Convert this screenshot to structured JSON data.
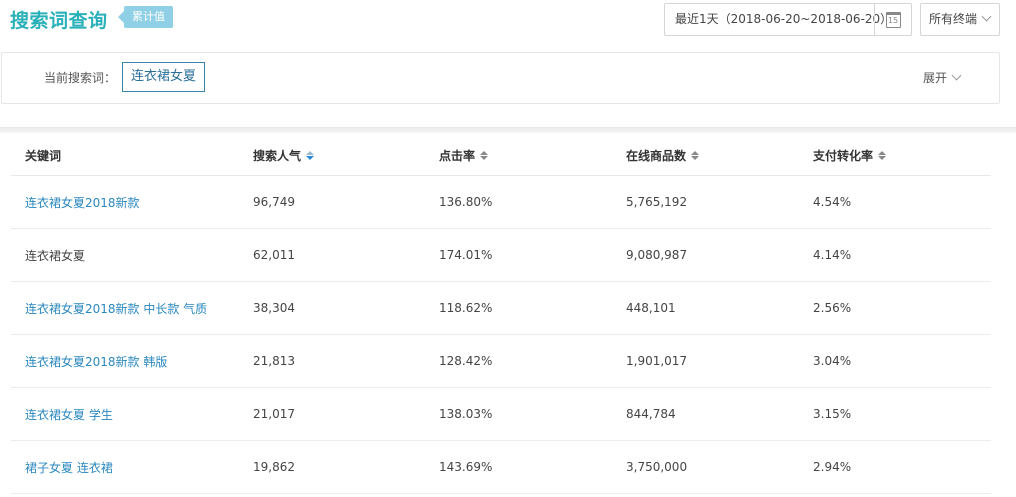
{
  "header": {
    "title": "搜索词查询",
    "badge": "累计值",
    "date_range": "最近1天（2018-06-20~2018-06-20）",
    "calendar_day": "15",
    "terminal": "所有终端"
  },
  "search": {
    "label": "当前搜索词：",
    "term": "连衣裙女夏",
    "expand": "展开"
  },
  "table": {
    "columns": [
      "关键词",
      "搜索人气",
      "点击率",
      "在线商品数",
      "支付转化率"
    ],
    "rows": [
      {
        "keyword": "连衣裙女夏2018新款",
        "popularity": "96,749",
        "ctr": "136.80%",
        "products": "5,765,192",
        "conversion": "4.54%",
        "is_link": true
      },
      {
        "keyword": "连衣裙女夏",
        "popularity": "62,011",
        "ctr": "174.01%",
        "products": "9,080,987",
        "conversion": "4.14%",
        "is_link": false
      },
      {
        "keyword": "连衣裙女夏2018新款 中长款 气质",
        "popularity": "38,304",
        "ctr": "118.62%",
        "products": "448,101",
        "conversion": "2.56%",
        "is_link": true
      },
      {
        "keyword": "连衣裙女夏2018新款 韩版",
        "popularity": "21,813",
        "ctr": "128.42%",
        "products": "1,901,017",
        "conversion": "3.04%",
        "is_link": true
      },
      {
        "keyword": "连衣裙女夏 学生",
        "popularity": "21,017",
        "ctr": "138.03%",
        "products": "844,784",
        "conversion": "3.15%",
        "is_link": true
      },
      {
        "keyword": "裙子女夏 连衣裙",
        "popularity": "19,862",
        "ctr": "143.69%",
        "products": "3,750,000",
        "conversion": "2.94%",
        "is_link": true
      }
    ]
  },
  "colors": {
    "title": "#2ab0b8",
    "link": "#2a88bf",
    "badge": "#8fd0e6"
  }
}
